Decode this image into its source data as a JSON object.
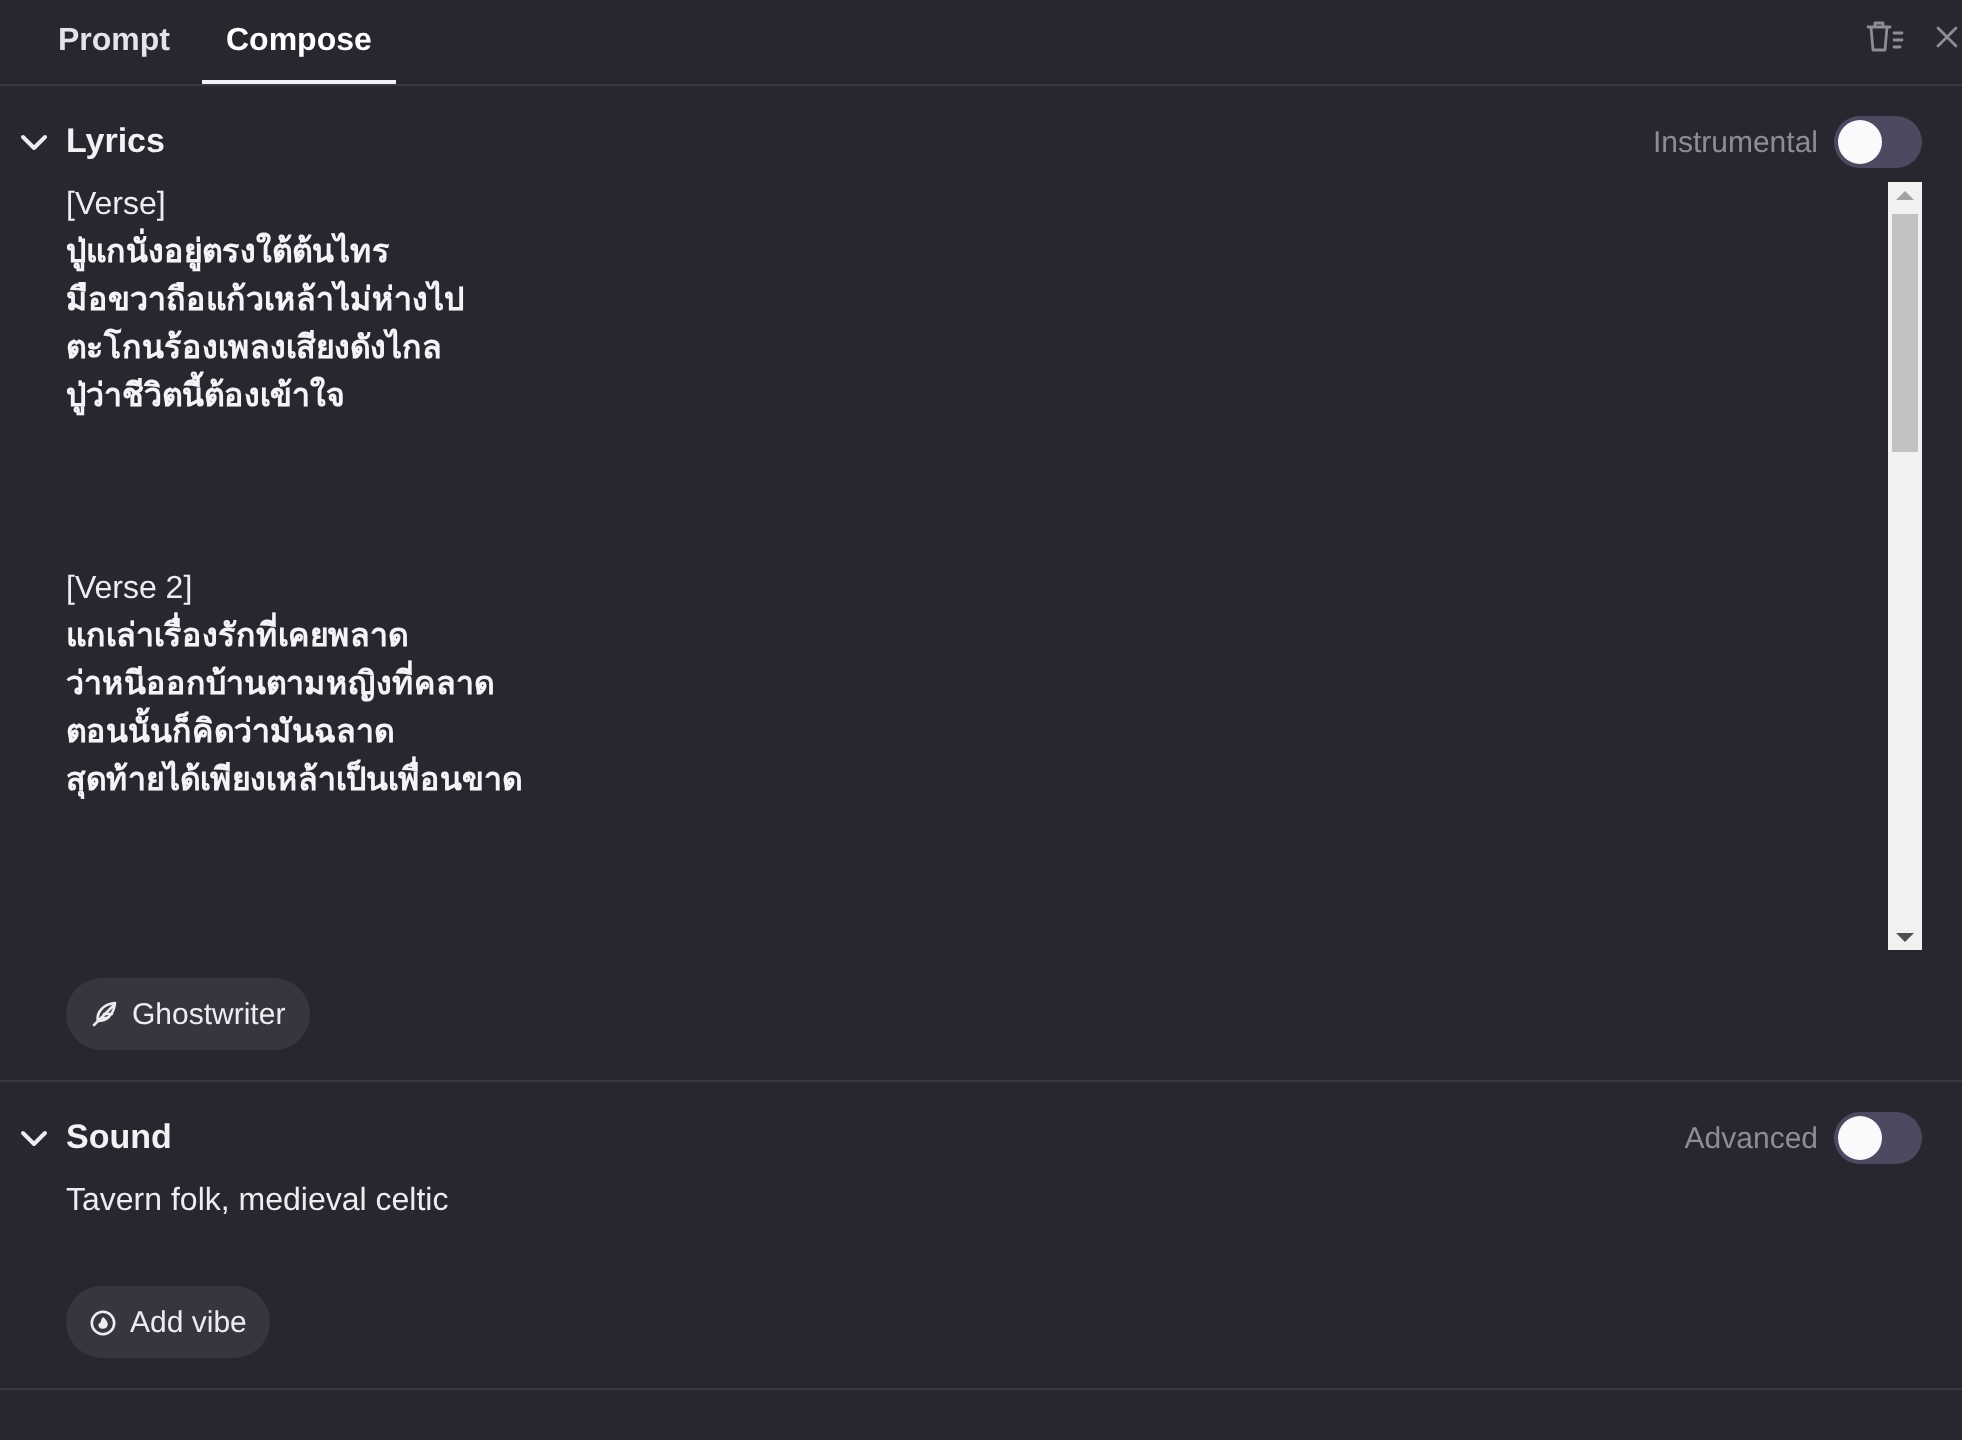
{
  "tabs": [
    {
      "label": "Prompt",
      "selected": false
    },
    {
      "label": "Compose",
      "selected": true
    }
  ],
  "sections": [
    {
      "kind": "lyrics",
      "title": "Lyrics",
      "expanded": true,
      "toggle": {
        "label": "Instrumental",
        "on": false
      },
      "lyrics": [
        {
          "tag": "[Verse]",
          "lines": [
            "ปู่แกนั่งอยู่ตรงใต้ต้นไทร",
            "มือขวาถือแก้วเหล้าไม่ห่างไป",
            "ตะโกนร้องเพลงเสียงดังไกล",
            "ปู่ว่าชีวิตนี้ต้องเข้าใจ"
          ]
        },
        {
          "tag": "[Verse 2]",
          "lines": [
            "แกเล่าเรื่องรักที่เคยพลาด",
            "ว่าหนีออกบ้านตามหญิงที่คลาด",
            "ตอนนั้นก็คิดว่ามันฉลาด",
            "สุดท้ายได้เพียงเหล้าเป็นเพื่อนขาด"
          ]
        }
      ],
      "button": {
        "label": "Ghostwriter"
      }
    },
    {
      "kind": "sound",
      "title": "Sound",
      "expanded": true,
      "toggle": {
        "label": "Advanced",
        "on": false
      },
      "value": "Tavern folk, medieval celtic",
      "button": {
        "label": "Add vibe"
      }
    }
  ]
}
